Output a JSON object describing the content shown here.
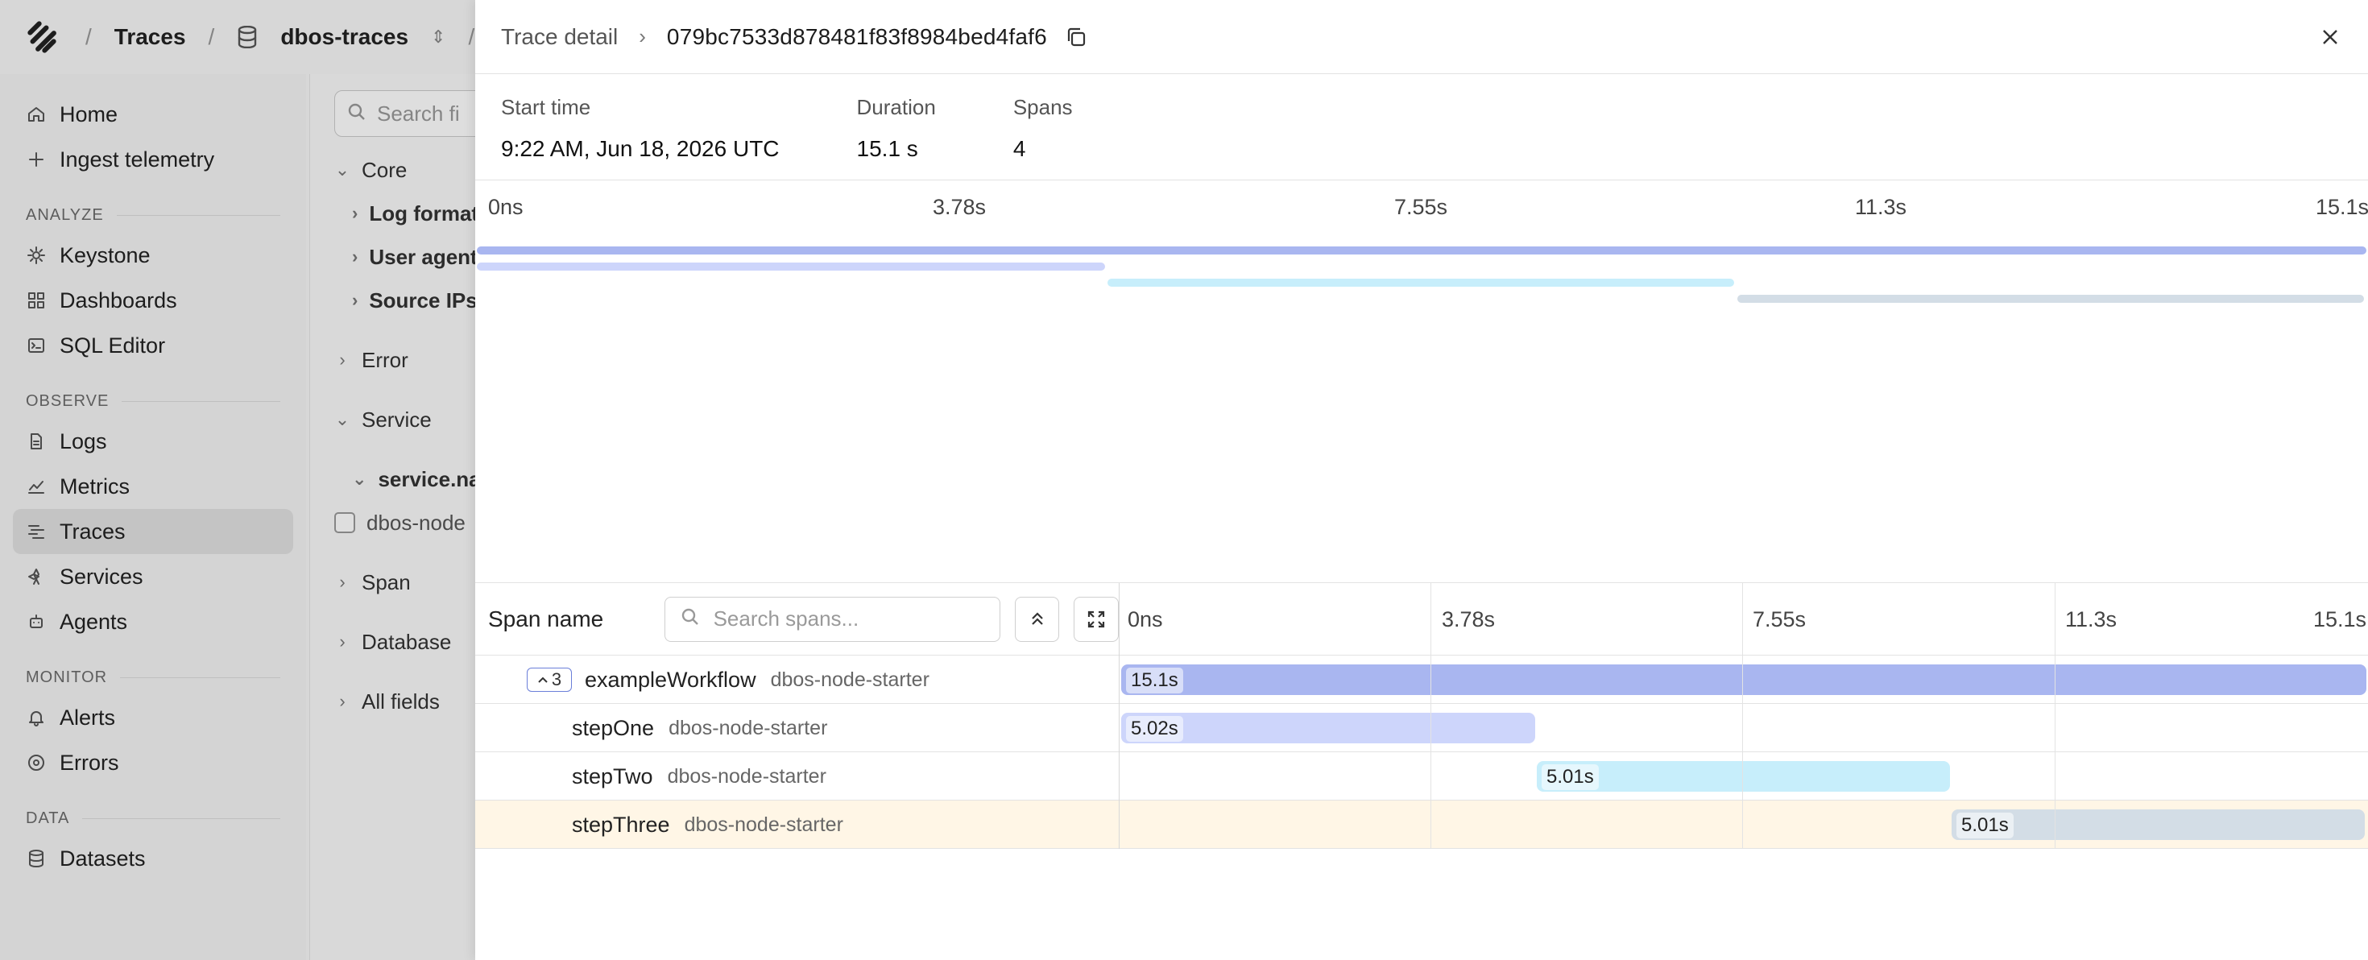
{
  "app": {
    "breadcrumb": [
      "Traces",
      "dbos-traces"
    ]
  },
  "sidebar": {
    "top_items": [
      {
        "label": "Home",
        "icon": "home-icon"
      },
      {
        "label": "Ingest telemetry",
        "icon": "plus-icon"
      }
    ],
    "sections": [
      {
        "title": "ANALYZE",
        "items": [
          {
            "label": "Keystone",
            "icon": "sparkle-icon"
          },
          {
            "label": "Dashboards",
            "icon": "dashboard-icon"
          },
          {
            "label": "SQL Editor",
            "icon": "terminal-icon"
          }
        ]
      },
      {
        "title": "OBSERVE",
        "items": [
          {
            "label": "Logs",
            "icon": "file-icon"
          },
          {
            "label": "Metrics",
            "icon": "chart-icon"
          },
          {
            "label": "Traces",
            "icon": "traces-icon",
            "active": true
          },
          {
            "label": "Services",
            "icon": "services-icon"
          },
          {
            "label": "Agents",
            "icon": "robot-icon"
          }
        ]
      },
      {
        "title": "MONITOR",
        "items": [
          {
            "label": "Alerts",
            "icon": "bell-icon"
          },
          {
            "label": "Errors",
            "icon": "error-icon"
          }
        ]
      },
      {
        "title": "DATA",
        "items": [
          {
            "label": "Datasets",
            "icon": "database-icon"
          }
        ]
      }
    ]
  },
  "filters": {
    "search_placeholder": "Search fi",
    "core": "Core",
    "core_items": [
      "Log format",
      "User agent",
      "Source IPs"
    ],
    "error": "Error",
    "service": "Service",
    "service_name": "service.na",
    "service_value": "dbos-node",
    "span": "Span",
    "database": "Database",
    "all_fields": "All fields"
  },
  "trace": {
    "crumb": "Trace detail",
    "trace_id": "079bc7533d878481f83f8984bed4faf6",
    "start_time_label": "Start time",
    "start_time": "9:22 AM, Jun 18, 2026 UTC",
    "duration_label": "Duration",
    "duration": "15.1 s",
    "spans_label": "Spans",
    "spans": "4"
  },
  "timeline": {
    "ticks": [
      "0ns",
      "3.78s",
      "7.55s",
      "11.3s",
      "15.1s"
    ],
    "total_s": 15.1
  },
  "spans_table": {
    "header": "Span name",
    "search_placeholder": "Search spans...",
    "child_count": "3",
    "rows": [
      {
        "name": "exampleWorkflow",
        "service": "dbos-node-starter",
        "start_s": 0,
        "duration_s": 15.1,
        "duration_label": "15.1s",
        "color": "#a9b6f0",
        "depth": 0
      },
      {
        "name": "stepOne",
        "service": "dbos-node-starter",
        "start_s": 0,
        "duration_s": 5.02,
        "duration_label": "5.02s",
        "color": "#cdd5fb",
        "depth": 1
      },
      {
        "name": "stepTwo",
        "service": "dbos-node-starter",
        "start_s": 5.04,
        "duration_s": 5.01,
        "duration_label": "5.01s",
        "color": "#c7eefb",
        "depth": 1
      },
      {
        "name": "stepThree",
        "service": "dbos-node-starter",
        "start_s": 10.07,
        "duration_s": 5.01,
        "duration_label": "5.01s",
        "color": "#d3dde6",
        "depth": 1,
        "highlight": true
      }
    ]
  }
}
